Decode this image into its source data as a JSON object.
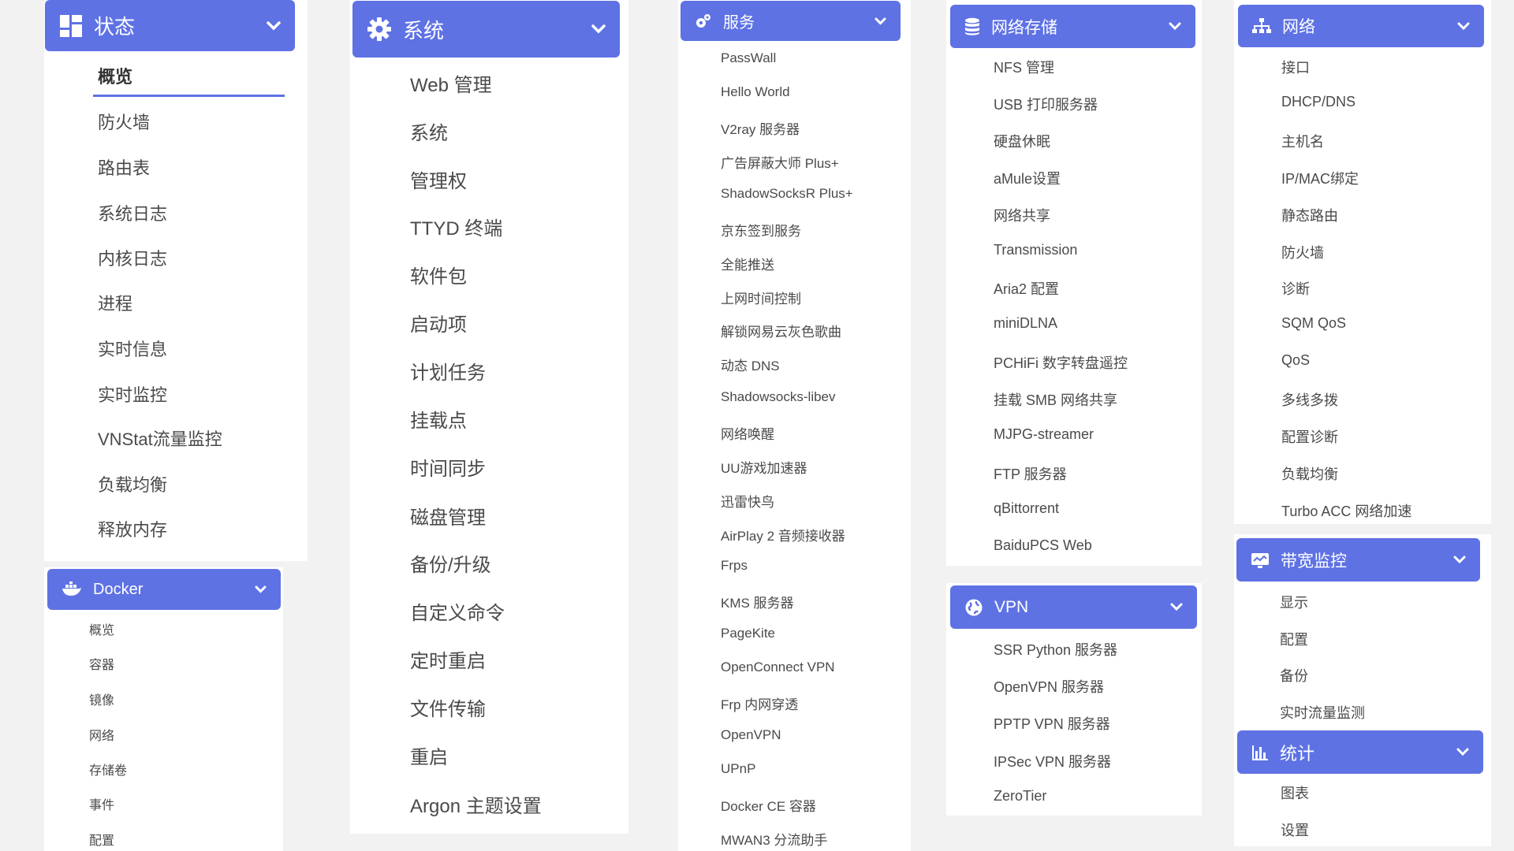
{
  "colors": {
    "accent": "#5e72e4",
    "text": "#4a4a4a",
    "background": "#f2f2f3",
    "panel": "#ffffff"
  },
  "status": {
    "title": "状态",
    "icon": "dashboard-icon",
    "items": [
      "概览",
      "防火墙",
      "路由表",
      "系统日志",
      "内核日志",
      "进程",
      "实时信息",
      "实时监控",
      "VNStat流量监控",
      "负载均衡",
      "释放内存"
    ],
    "active": "概览"
  },
  "docker": {
    "title": "Docker",
    "icon": "docker-icon",
    "items": [
      "概览",
      "容器",
      "镜像",
      "网络",
      "存储卷",
      "事件",
      "配置"
    ]
  },
  "system": {
    "title": "系统",
    "icon": "gear-icon",
    "items": [
      "Web 管理",
      "系统",
      "管理权",
      "TTYD 终端",
      "软件包",
      "启动项",
      "计划任务",
      "挂载点",
      "时间同步",
      "磁盘管理",
      "备份/升级",
      "自定义命令",
      "定时重启",
      "文件传输",
      "重启",
      "Argon 主题设置"
    ]
  },
  "services": {
    "title": "服务",
    "icon": "cogs-icon",
    "items": [
      "PassWall",
      "Hello World",
      "V2ray 服务器",
      "广告屏蔽大师 Plus+",
      "ShadowSocksR Plus+",
      "京东签到服务",
      "全能推送",
      "上网时间控制",
      "解锁网易云灰色歌曲",
      "动态 DNS",
      "Shadowsocks-libev",
      "网络唤醒",
      "UU游戏加速器",
      "迅雷快鸟",
      "AirPlay 2 音频接收器",
      "Frps",
      "KMS 服务器",
      "PageKite",
      "OpenConnect VPN",
      "Frp 内网穿透",
      "OpenVPN",
      "UPnP",
      "Docker CE 容器",
      "MWAN3 分流助手"
    ]
  },
  "nas": {
    "title": "网络存储",
    "icon": "database-icon",
    "items": [
      "NFS 管理",
      "USB 打印服务器",
      "硬盘休眠",
      "aMule设置",
      "网络共享",
      "Transmission",
      "Aria2 配置",
      "miniDLNA",
      "PCHiFi 数字转盘遥控",
      "挂载 SMB 网络共享",
      "MJPG-streamer",
      "FTP 服务器",
      "qBittorrent",
      "BaiduPCS Web"
    ]
  },
  "vpn": {
    "title": "VPN",
    "icon": "globe-icon",
    "items": [
      "SSR Python 服务器",
      "OpenVPN 服务器",
      "PPTP VPN 服务器",
      "IPSec VPN 服务器",
      "ZeroTier"
    ]
  },
  "network": {
    "title": "网络",
    "icon": "sitemap-icon",
    "items": [
      "接口",
      "DHCP/DNS",
      "主机名",
      "IP/MAC绑定",
      "静态路由",
      "防火墙",
      "诊断",
      "SQM QoS",
      "QoS",
      "多线多拨",
      "配置诊断",
      "负载均衡",
      "Turbo ACC 网络加速"
    ]
  },
  "bandwidth": {
    "title": "带宽监控",
    "icon": "monitor-chart-icon",
    "items": [
      "显示",
      "配置",
      "备份",
      "实时流量监测"
    ]
  },
  "stats": {
    "title": "统计",
    "icon": "bar-chart-icon",
    "items": [
      "图表",
      "设置"
    ]
  }
}
